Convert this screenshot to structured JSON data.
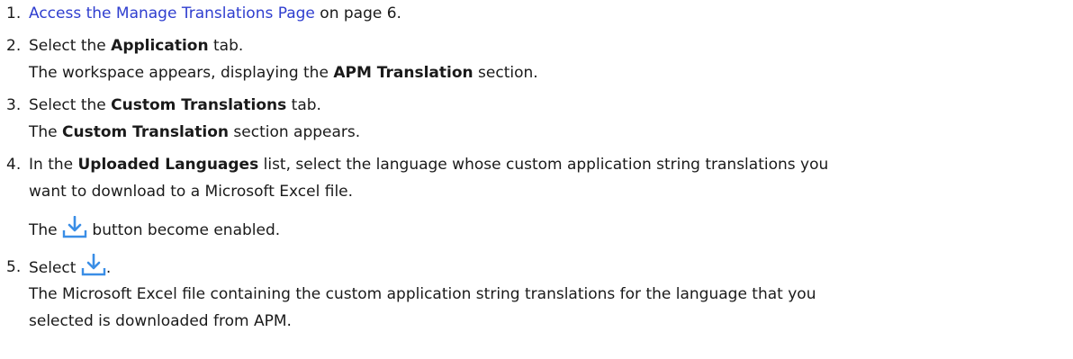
{
  "steps": [
    {
      "number": "1.",
      "link_text": "Access the Manage Translations Page",
      "after_link": " on page 6."
    },
    {
      "number": "2.",
      "before": "Select the ",
      "bold": "Application",
      "after": " tab.",
      "result_before": "The workspace appears, displaying the ",
      "result_bold": "APM Translation",
      "result_after": " section."
    },
    {
      "number": "3.",
      "before": "Select the ",
      "bold": "Custom Translations",
      "after": " tab.",
      "result_before": "The ",
      "result_bold": "Custom Translation",
      "result_after": " section appears."
    },
    {
      "number": "4.",
      "before": "In the ",
      "bold": "Uploaded Languages",
      "after": " list, select the language whose custom application string translations you",
      "after_line2": "want to download to a Microsoft Excel file.",
      "result_before": "The ",
      "result_after": " button become enabled."
    },
    {
      "number": "5.",
      "before": "Select ",
      "after": ".",
      "result_line1": "The Microsoft Excel file containing the custom application string translations for the language that you",
      "result_line2": "selected is downloaded from APM."
    }
  ],
  "icons": {
    "download": "download-icon",
    "color": "#3a8ee6"
  }
}
